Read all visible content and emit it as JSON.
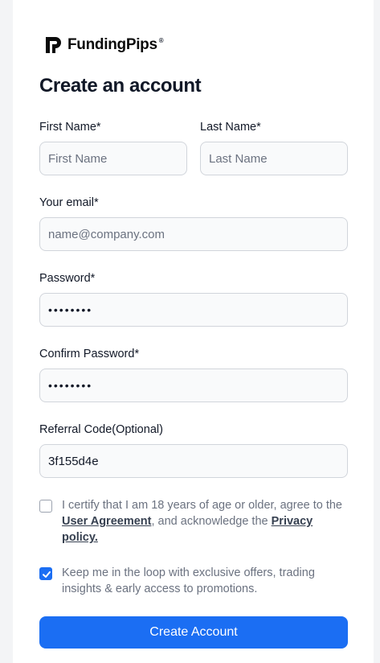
{
  "brand": {
    "name": "FundingPips",
    "mark": "®"
  },
  "title": "Create an account",
  "fields": {
    "first_name": {
      "label": "First Name*",
      "placeholder": "First Name",
      "value": ""
    },
    "last_name": {
      "label": "Last Name*",
      "placeholder": "Last Name",
      "value": ""
    },
    "email": {
      "label": "Your email*",
      "placeholder": "name@company.com",
      "value": ""
    },
    "password": {
      "label": "Password*",
      "value": "••••••••"
    },
    "confirm_password": {
      "label": "Confirm Password*",
      "value": "••••••••"
    },
    "referral": {
      "label": "Referral Code(Optional)",
      "value": "3f155d4e"
    }
  },
  "agreement": {
    "checked": false,
    "text_1": "I certify that I am 18 years of age or older, agree to the",
    "link_1": " User Agreement",
    "text_2": ", and acknowledge the ",
    "link_2": "Privacy policy.",
    "text_3": ""
  },
  "newsletter": {
    "checked": true,
    "text": "Keep me in the loop with exclusive offers, trading insights & early access to promotions."
  },
  "submit_label": "Create Account",
  "colors": {
    "accent": "#1b6ef3",
    "background": "#f3f4f6"
  }
}
